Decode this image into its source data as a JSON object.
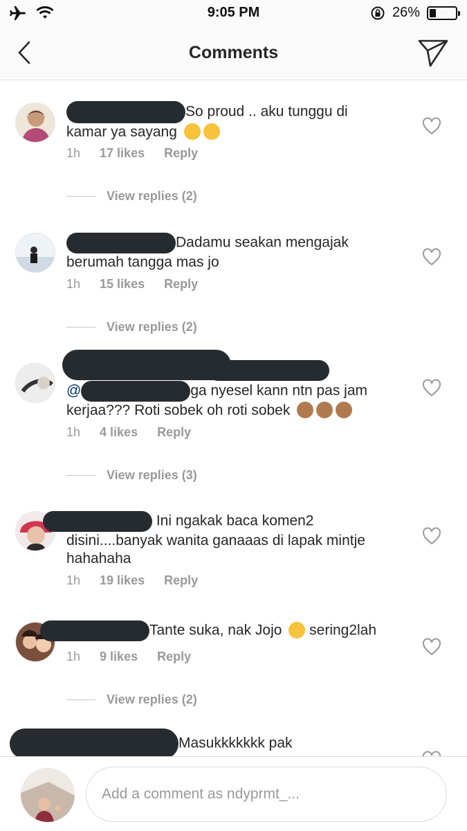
{
  "status": {
    "time": "9:05 PM",
    "battery": "26%",
    "battery_level": 0.26
  },
  "nav": {
    "title": "Comments"
  },
  "comments": [
    {
      "text": "So proud .. aku tunggu di kamar ya sayang",
      "time": "1h",
      "likes": "17 likes",
      "reply": "Reply",
      "view_replies": "View replies (2)"
    },
    {
      "text": "Dadamu seakan mengajak berumah tangga mas jo",
      "time": "1h",
      "likes": "15 likes",
      "reply": "Reply",
      "view_replies": "View replies (2)"
    },
    {
      "mention": "@",
      "text": "ga nyesel kann ntn pas jam kerjaa??? Roti sobek oh roti sobek",
      "time": "1h",
      "likes": "4 likes",
      "reply": "Reply",
      "view_replies": "View replies (3)"
    },
    {
      "text": "Ini ngakak baca komen2 disini....banyak wanita ganaaas di lapak mintje hahahaha",
      "time": "1h",
      "likes": "19 likes",
      "reply": "Reply"
    },
    {
      "text": "Tante suka, nak Jojo",
      "text2": "sering2lah",
      "time": "1h",
      "likes": "9 likes",
      "reply": "Reply",
      "view_replies": "View replies (2)"
    },
    {
      "text": "Masukkkkkkk pak"
    }
  ],
  "compose": {
    "placeholder": "Add a comment as ndyprmt_..."
  },
  "icons": [
    "airplane-icon",
    "wifi-icon",
    "orientation-lock-icon",
    "battery-icon",
    "back-chevron-icon",
    "direct-share-icon",
    "heart-icon"
  ],
  "colors": {
    "text": "#262626",
    "muted": "#999999",
    "redaction": "#262b30",
    "divider": "#dbdbdb"
  }
}
